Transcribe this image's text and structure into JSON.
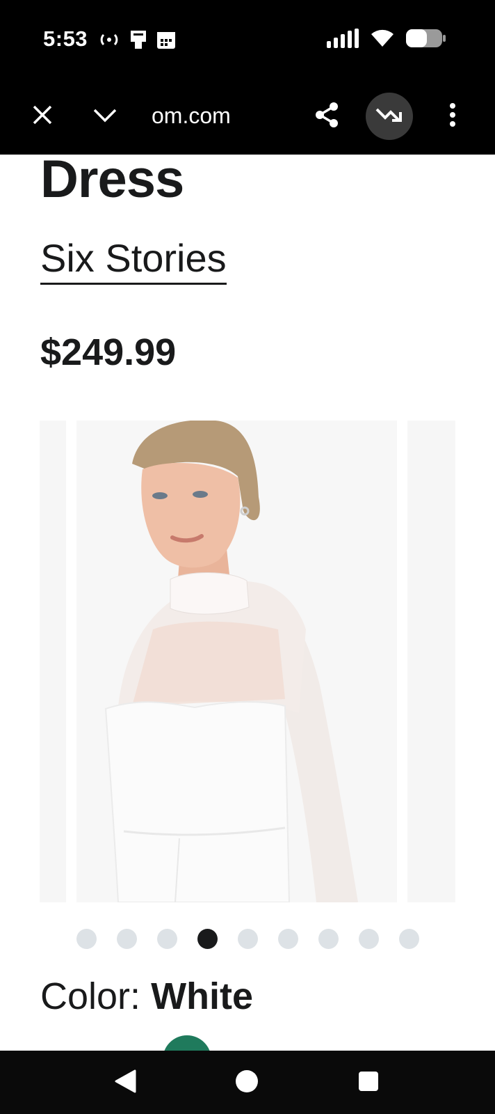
{
  "status_bar": {
    "time": "5:53",
    "left_icons": [
      "hotspot-icon",
      "sim-card-icon",
      "calendar-icon"
    ],
    "right_icons": [
      "signal-icon",
      "wifi-icon",
      "battery-icon"
    ]
  },
  "browser": {
    "url": "om.com",
    "buttons": [
      "close-icon",
      "chevron-down-icon",
      "share-icon",
      "price-drop-icon",
      "more-vertical-icon"
    ]
  },
  "product": {
    "title": "Dress",
    "brand": "Six Stories",
    "price": "$249.99"
  },
  "gallery": {
    "image_count": 9,
    "active_index": 3
  },
  "color": {
    "label": "Color:",
    "value": "White",
    "swatch_color": "#1f7a5c"
  },
  "nav_bar": {
    "buttons": [
      "back-icon",
      "home-icon",
      "recents-icon"
    ]
  },
  "colors": {
    "text": "#191a1b",
    "dot_inactive": "#dde2e6",
    "dot_active": "#191a1b",
    "bar_background": "#000000"
  }
}
